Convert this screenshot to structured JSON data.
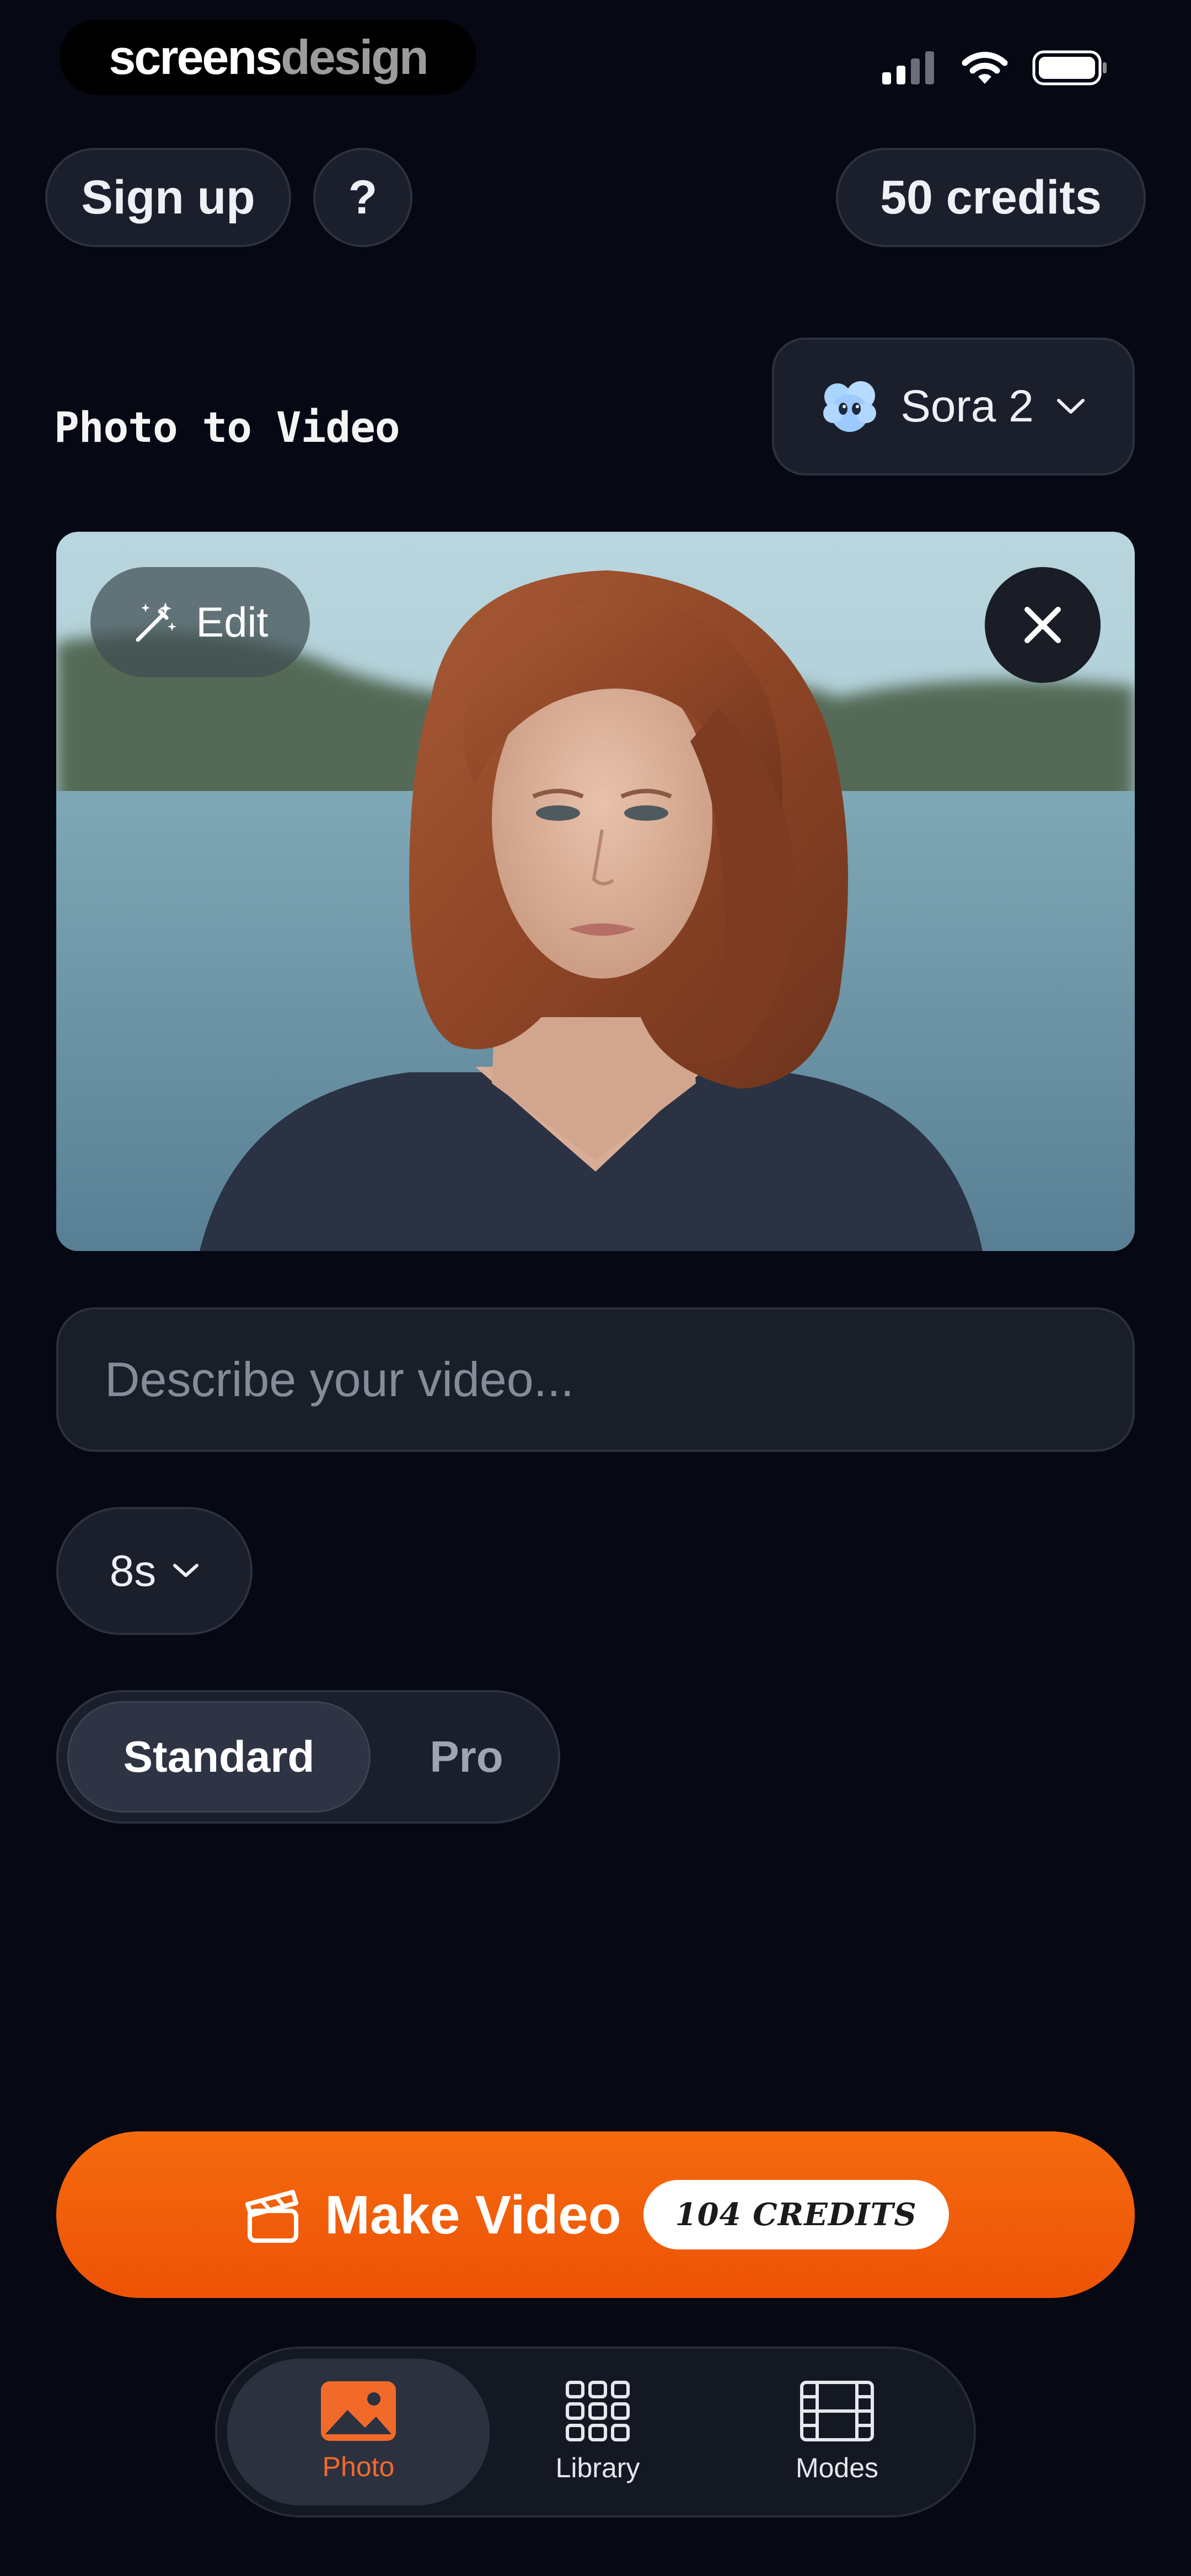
{
  "status_bar": {
    "brand_part1": "screens",
    "brand_part2": "design"
  },
  "header": {
    "signup_label": "Sign up",
    "help_label": "?",
    "credits_label": "50 credits"
  },
  "mode": {
    "title": "Photo to Video"
  },
  "model_selector": {
    "label": "Sora 2",
    "icon": "cloud-face-icon"
  },
  "photo": {
    "edit_label": "Edit"
  },
  "prompt": {
    "placeholder": "Describe your video...",
    "value": ""
  },
  "duration": {
    "label": "8s"
  },
  "quality": {
    "options": [
      "Standard",
      "Pro"
    ],
    "selected": "Standard"
  },
  "make_button": {
    "label": "Make Video",
    "credits": "104 CREDITS"
  },
  "tabs": [
    {
      "label": "Photo",
      "icon": "photo-icon",
      "active": true
    },
    {
      "label": "Library",
      "icon": "grid-icon",
      "active": false
    },
    {
      "label": "Modes",
      "icon": "film-icon",
      "active": false
    }
  ],
  "colors": {
    "background": "#060814",
    "accent": "#f26a2a",
    "button": "#f05a08"
  }
}
